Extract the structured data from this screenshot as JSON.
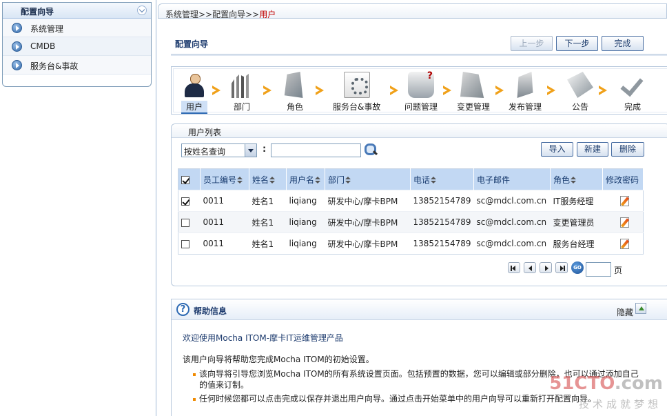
{
  "sidebar": {
    "title": "配置向导",
    "items": [
      {
        "label": "系统管理"
      },
      {
        "label": "CMDB"
      },
      {
        "label": "服务台&事故"
      }
    ]
  },
  "breadcrumb": {
    "path": "系统管理>>配置向导>>",
    "current": "用户"
  },
  "wizard": {
    "title": "配置向导",
    "prev_label": "上一步",
    "next_label": "下一步",
    "finish_label": "完成",
    "steps": [
      {
        "label": "用户",
        "icon": "user-icon",
        "active": true
      },
      {
        "label": "部门",
        "icon": "department-icon"
      },
      {
        "label": "角色",
        "icon": "role-icon"
      },
      {
        "label": "服务台&事故",
        "icon": "service-desk-icon"
      },
      {
        "label": "问题管理",
        "icon": "problem-icon"
      },
      {
        "label": "变更管理",
        "icon": "change-icon"
      },
      {
        "label": "发布管理",
        "icon": "release-icon"
      },
      {
        "label": "公告",
        "icon": "notice-icon"
      },
      {
        "label": "完成",
        "icon": "checkmark-icon"
      }
    ]
  },
  "user_list": {
    "tab_label": "用户列表",
    "query_select": "按姓名查询",
    "colon": ":",
    "search_value": "",
    "import_label": "导入",
    "new_label": "新建",
    "delete_label": "删除",
    "columns": [
      "员工编号",
      "姓名",
      "用户名",
      "部门",
      "电话",
      "电子邮件",
      "角色",
      "修改密码"
    ],
    "rows": [
      {
        "checked": true,
        "id": "0011",
        "name": "姓名1",
        "username": "liqiang",
        "dept": "研发中心/摩卡BPM",
        "phone": "13852154789",
        "email": "sc@mdcl.com.cn",
        "role": "IT服务经理"
      },
      {
        "checked": false,
        "id": "0011",
        "name": "姓名1",
        "username": "liqiang",
        "dept": "研发中心/摩卡BPM",
        "phone": "13852154789",
        "email": "sc@mdcl.com.cn",
        "role": "变更管理员"
      },
      {
        "checked": false,
        "id": "0011",
        "name": "姓名1",
        "username": "liqiang",
        "dept": "研发中心/摩卡BPM",
        "phone": "13852154789",
        "email": "sc@mdcl.com.cn",
        "role": "服务台经理"
      }
    ],
    "pager": {
      "go_label": "GO",
      "page_value": "",
      "page_suffix": "页"
    }
  },
  "help": {
    "title": "帮助信息",
    "hide_label": "隐藏",
    "welcome": "欢迎使用Mocha ITOM-摩卡IT运维管理产品",
    "intro": "该用户向导将帮助您完成Mocha ITOM的初始设置。",
    "bullets": [
      "该向导将引导您浏览Mocha ITOM的所有系统设置页面。包括预置的数据，您可以编辑或部分删除，也可以通过添加自己的值来订制。",
      "任何时候您都可以点击完成以保存并退出用户向导。通过点击开始菜单中的用户向导可以重新打开配置向导。"
    ]
  },
  "watermark": {
    "logo_a": "51CTO",
    "logo_b": ".com",
    "slogan": "技术成就梦想"
  }
}
